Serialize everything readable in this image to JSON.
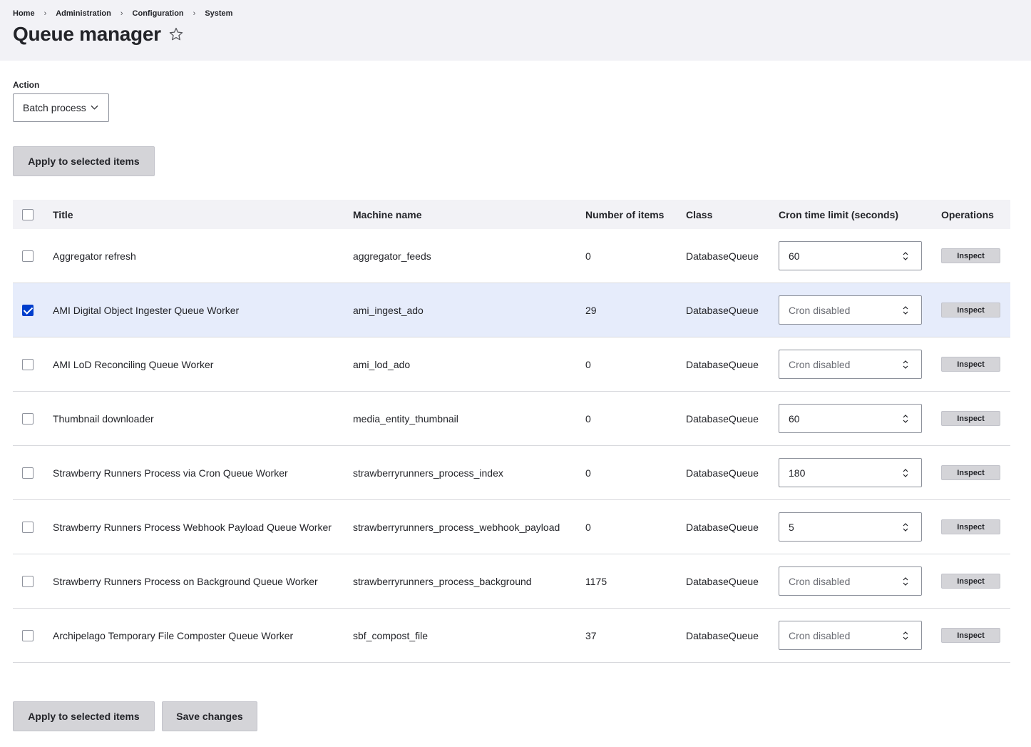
{
  "breadcrumb": [
    "Home",
    "Administration",
    "Configuration",
    "System"
  ],
  "breadcrumb_separator": "›",
  "page": {
    "title": "Queue manager"
  },
  "action": {
    "label": "Action",
    "selected": "Batch process"
  },
  "buttons": {
    "apply_top": "Apply to selected items",
    "apply_bottom": "Apply to selected items",
    "save": "Save changes"
  },
  "table": {
    "headers": {
      "title": "Title",
      "machine": "Machine name",
      "number": "Number of items",
      "class": "Class",
      "cron": "Cron time limit (seconds)",
      "operations": "Operations"
    },
    "inspect_label": "Inspect",
    "cron_placeholder": "Cron disabled",
    "rows": [
      {
        "title": "Aggregator refresh",
        "machine": "aggregator_feeds",
        "number": "0",
        "class": "DatabaseQueue",
        "cron": "60",
        "checked": false
      },
      {
        "title": "AMI Digital Object Ingester Queue Worker",
        "machine": "ami_ingest_ado",
        "number": "29",
        "class": "DatabaseQueue",
        "cron": "",
        "checked": true
      },
      {
        "title": "AMI LoD Reconciling Queue Worker",
        "machine": "ami_lod_ado",
        "number": "0",
        "class": "DatabaseQueue",
        "cron": "",
        "checked": false
      },
      {
        "title": "Thumbnail downloader",
        "machine": "media_entity_thumbnail",
        "number": "0",
        "class": "DatabaseQueue",
        "cron": "60",
        "checked": false
      },
      {
        "title": "Strawberry Runners Process via Cron Queue Worker",
        "machine": "strawberryrunners_process_index",
        "number": "0",
        "class": "DatabaseQueue",
        "cron": "180",
        "checked": false
      },
      {
        "title": "Strawberry Runners Process Webhook Payload Queue Worker",
        "machine": "strawberryrunners_process_webhook_payload",
        "number": "0",
        "class": "DatabaseQueue",
        "cron": "5",
        "checked": false
      },
      {
        "title": "Strawberry Runners Process on Background Queue Worker",
        "machine": "strawberryrunners_process_background",
        "number": "1175",
        "class": "DatabaseQueue",
        "cron": "",
        "checked": false
      },
      {
        "title": "Archipelago Temporary File Composter Queue Worker",
        "machine": "sbf_compost_file",
        "number": "37",
        "class": "DatabaseQueue",
        "cron": "",
        "checked": false
      }
    ]
  },
  "colors": {
    "header_bg": "#f2f2f6",
    "selected_row_bg": "#e6ecfb",
    "checkbox_checked": "#003ecc",
    "button_bg": "#d4d4d8"
  },
  "icons": {
    "favorite": "star-outline-icon",
    "select": "chevron-down-icon",
    "number_spinner": "spinner-arrows-icon"
  }
}
